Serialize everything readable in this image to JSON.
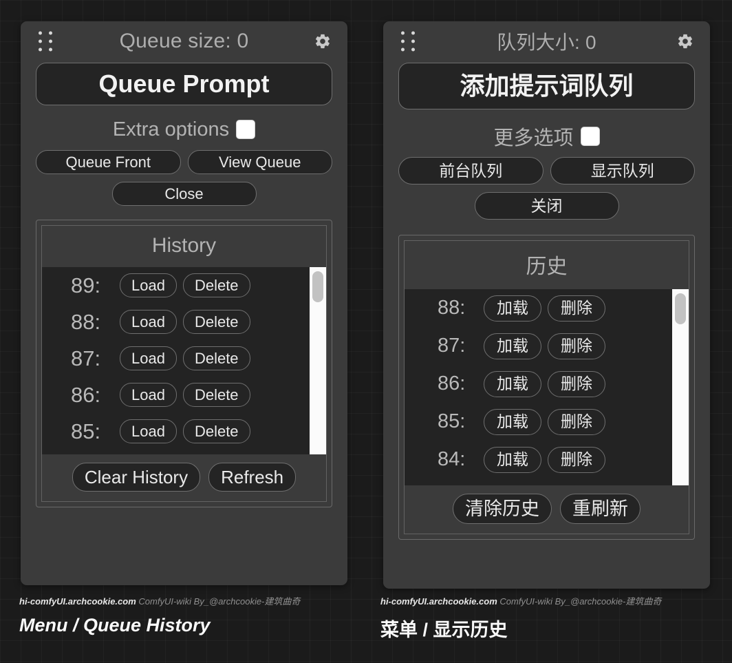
{
  "background": {
    "color": "#1b1b1b",
    "grid_color": "#262626",
    "grid_size_px": 30
  },
  "panels": [
    {
      "lang": "en",
      "drag_handle_icon": "drag-dots-icon",
      "queue_size_label": "Queue size: 0",
      "settings_icon": "gear-icon",
      "queue_prompt_label": "Queue Prompt",
      "extra_options_label": "Extra options",
      "extra_options_checked": false,
      "queue_front_label": "Queue Front",
      "view_queue_label": "View Queue",
      "close_label": "Close",
      "history_title": "History",
      "history_rows": [
        {
          "id": "89:",
          "load": "Load",
          "delete": "Delete"
        },
        {
          "id": "88:",
          "load": "Load",
          "delete": "Delete"
        },
        {
          "id": "87:",
          "load": "Load",
          "delete": "Delete"
        },
        {
          "id": "86:",
          "load": "Load",
          "delete": "Delete"
        },
        {
          "id": "85:",
          "load": "Load",
          "delete": "Delete"
        }
      ],
      "clear_history_label": "Clear History",
      "refresh_label": "Refresh",
      "watermark": {
        "site": "hi-comfyUI.archcookie.com",
        "wiki": "ComfyUI-wiki",
        "author": "By_@archcookie-建筑曲奇"
      },
      "caption": "Menu / Queue History"
    },
    {
      "lang": "zh",
      "drag_handle_icon": "drag-dots-icon",
      "queue_size_label": "队列大小: 0",
      "settings_icon": "gear-icon",
      "queue_prompt_label": "添加提示词队列",
      "extra_options_label": "更多选项",
      "extra_options_checked": false,
      "queue_front_label": "前台队列",
      "view_queue_label": "显示队列",
      "close_label": "关闭",
      "history_title": "历史",
      "history_rows": [
        {
          "id": "88:",
          "load": "加载",
          "delete": "删除"
        },
        {
          "id": "87:",
          "load": "加载",
          "delete": "删除"
        },
        {
          "id": "86:",
          "load": "加载",
          "delete": "删除"
        },
        {
          "id": "85:",
          "load": "加载",
          "delete": "删除"
        },
        {
          "id": "84:",
          "load": "加载",
          "delete": "删除"
        }
      ],
      "clear_history_label": "清除历史",
      "refresh_label": "重刷新",
      "watermark": {
        "site": "hi-comfyUI.archcookie.com",
        "wiki": "ComfyUI-wiki",
        "author": "By_@archcookie-建筑曲奇"
      },
      "caption": "菜单 / 显示历史"
    }
  ]
}
